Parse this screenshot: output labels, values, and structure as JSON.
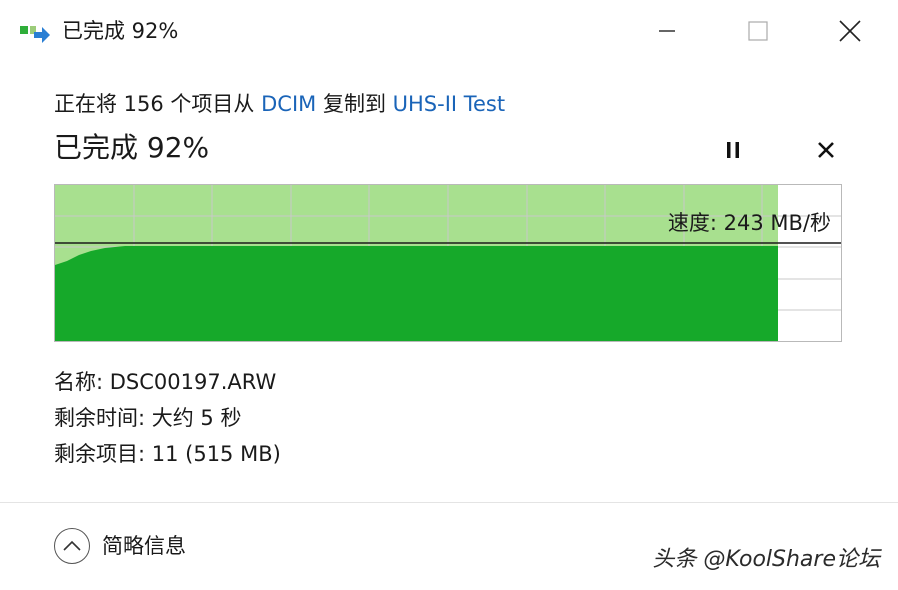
{
  "window": {
    "title": "已完成 92%",
    "controls": {
      "minimize": "minimize-icon",
      "maximize": "maximize-icon",
      "close": "close-icon"
    }
  },
  "copy": {
    "prefix": "正在将 156 个项目从 ",
    "source": "DCIM",
    "middle": " 复制到 ",
    "destination": "UHS-II Test"
  },
  "progress": {
    "title": "已完成 92%",
    "percent": 92,
    "pause_icon": "pause-icon",
    "cancel_icon": "cancel-icon"
  },
  "graph": {
    "speed_label": "速度: 243 MB/秒",
    "fill_fraction": 0.92,
    "current_speed_fraction": 0.63,
    "colors": {
      "fill": "#16a92a",
      "history": "#a8e08f",
      "grid": "#c9c9c9",
      "line": "#1a1a1a"
    }
  },
  "details": {
    "name": "名称: DSC00197.ARW",
    "time_remaining": "剩余时间: 大约 5 秒",
    "items_remaining": "剩余项目: 11 (515 MB)"
  },
  "footer": {
    "toggle_label": "简略信息",
    "toggle_icon": "chevron-up-icon",
    "watermark": "头条 @KoolShare论坛"
  }
}
